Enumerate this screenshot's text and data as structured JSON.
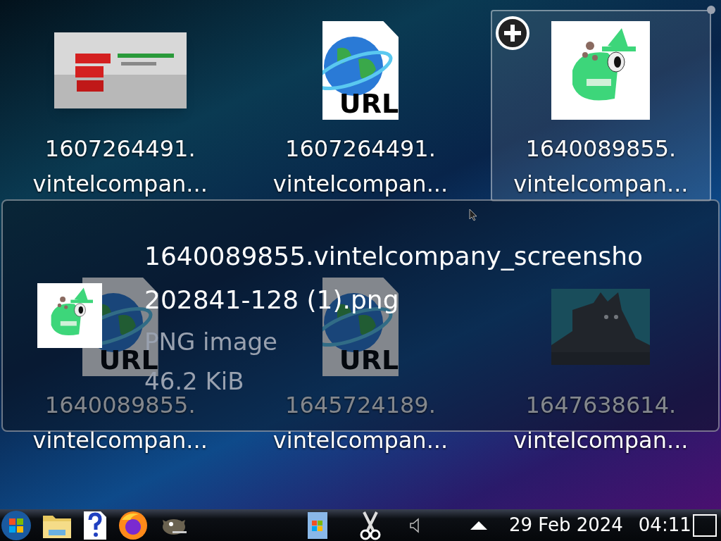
{
  "desktop": {
    "icons": [
      {
        "kind": "picture",
        "line1": "1607264491.",
        "line2": "vintelcompan...",
        "hovered": false
      },
      {
        "kind": "url",
        "badge": "URL",
        "line1": "1607264491.",
        "line2": "vintelcompan...",
        "hovered": false
      },
      {
        "kind": "picture",
        "line1": "1640089855.",
        "line2": "vintelcompan...",
        "hovered": true
      },
      {
        "kind": "url",
        "badge": "URL",
        "line1": "1640089855.",
        "line2": "vintelcompan...",
        "hovered": false
      },
      {
        "kind": "url",
        "badge": "URL",
        "line1": "1645724189.",
        "line2": "vintelcompan...",
        "hovered": false
      },
      {
        "kind": "picture",
        "line1": "1647638614.",
        "line2": "vintelcompan...",
        "hovered": false
      }
    ]
  },
  "tooltip": {
    "name_lines": [
      "1640089855.vintelcompany_screensho",
      "202841-128 (1).png"
    ],
    "type": "PNG image",
    "size": "46.2 KiB"
  },
  "taskbar": {
    "launchers": [
      {
        "kind": "start"
      },
      {
        "kind": "folder"
      },
      {
        "kind": "help"
      },
      {
        "kind": "browser"
      },
      {
        "kind": "gimp"
      }
    ],
    "tasks": [
      {
        "kind": "document"
      },
      {
        "kind": "scissors"
      }
    ],
    "date": "29 Feb 2024",
    "time": "04:11"
  }
}
